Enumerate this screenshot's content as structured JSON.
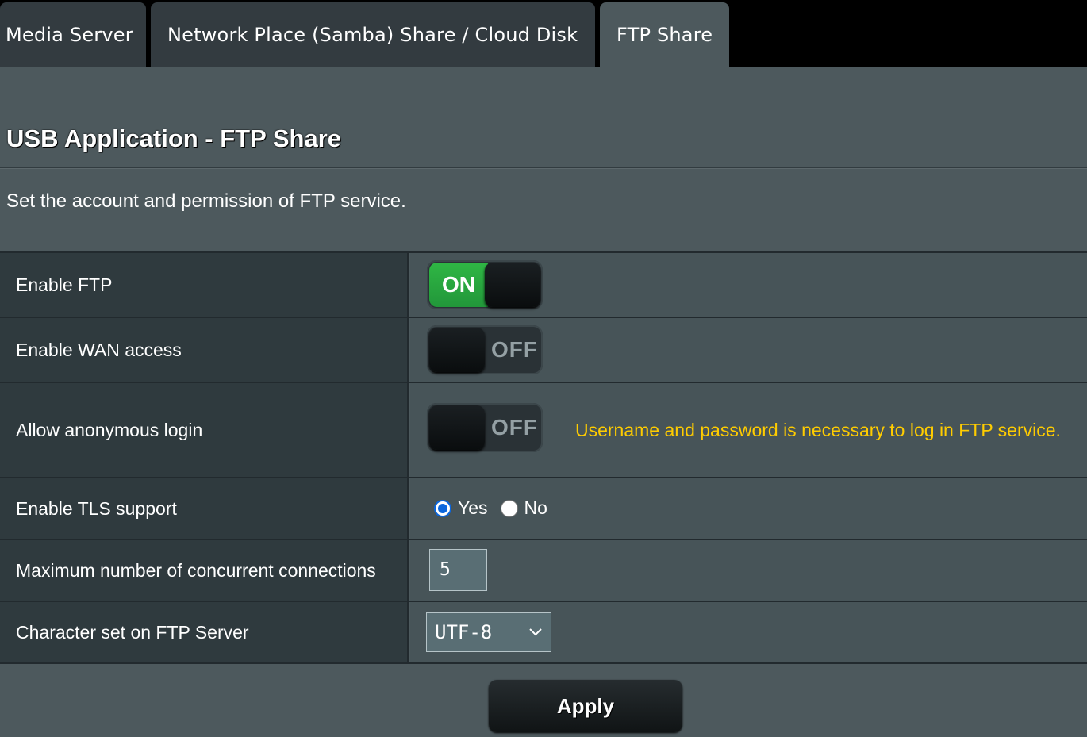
{
  "tabs": [
    {
      "label": "Media Server",
      "active": false
    },
    {
      "label": "Network Place (Samba) Share / Cloud Disk",
      "active": false
    },
    {
      "label": "FTP Share",
      "active": true
    }
  ],
  "page": {
    "title": "USB Application - FTP Share",
    "description": "Set the account and permission of FTP service."
  },
  "settings": {
    "enable_ftp": {
      "label": "Enable FTP",
      "state": "ON"
    },
    "enable_wan": {
      "label": "Enable WAN access",
      "state": "OFF"
    },
    "anonymous": {
      "label": "Allow anonymous login",
      "state": "OFF",
      "hint": "Username and password is necessary to log in FTP service."
    },
    "tls": {
      "label": "Enable TLS support",
      "yes_label": "Yes",
      "no_label": "No",
      "selected": "Yes"
    },
    "max_conn": {
      "label": "Maximum number of concurrent connections",
      "value": "5"
    },
    "charset": {
      "label": "Character set on FTP Server",
      "value": "UTF-8"
    }
  },
  "actions": {
    "apply_label": "Apply"
  },
  "colors": {
    "toggle_on": "#2fb644",
    "hint_text": "#ffcc00",
    "radio_checked": "#0b66dd",
    "panel_bg": "#4d595d"
  },
  "icons": {
    "select_arrow": "chevron-down-icon"
  }
}
